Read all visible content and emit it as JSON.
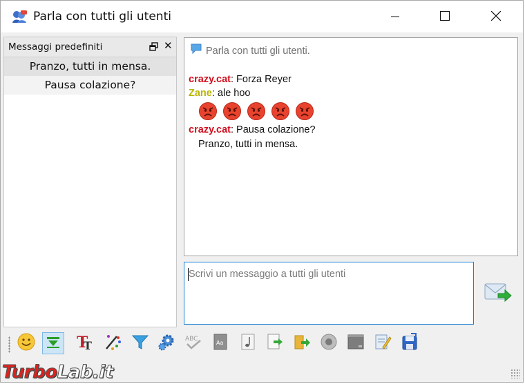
{
  "window": {
    "title": "Parla con tutti gli utenti",
    "icons": {
      "app": "chat-people-icon",
      "minimize": "minimize-icon",
      "maximize": "maximize-icon",
      "close": "close-icon"
    }
  },
  "predefined_panel": {
    "title": "Messaggi predefiniti",
    "float_icon": "float-window-icon",
    "close_label": "✕",
    "items": [
      {
        "label": "Pranzo, tutti in mensa.",
        "selected": true
      },
      {
        "label": "Pausa colazione?",
        "selected": false
      }
    ]
  },
  "chat": {
    "header": "Parla con tutti gli utenti.",
    "messages": [
      {
        "nick": "crazy.cat",
        "nick_color": "#d10f1e",
        "separator": ":",
        "text": " Forza Reyer"
      },
      {
        "nick": "Zane",
        "nick_color": "#b9b400",
        "separator": ":",
        "text": " ale hoo"
      },
      {
        "nick": "crazy.cat",
        "nick_color": "#d10f1e",
        "separator": ":",
        "text": " Pausa colazione?"
      }
    ],
    "continuation": "Pranzo, tutti in mensa.",
    "emojis": [
      "angry-face-icon",
      "angry-face-icon",
      "angry-face-icon",
      "angry-face-icon",
      "angry-face-icon"
    ]
  },
  "input": {
    "placeholder": "Scrivi un messaggio a tutti gli utenti",
    "send_icon": "send-message-icon"
  },
  "toolbar": {
    "items": [
      "smiley-icon",
      "collapse-panel-icon",
      "font-icon",
      "color-picker-icon",
      "filter-icon",
      "settings-gear-icon",
      "spellcheck-icon",
      "dictionary-icon",
      "sound-icon",
      "insert-file-icon",
      "export-icon",
      "record-icon",
      "screen-icon",
      "edit-note-icon",
      "save-icon"
    ],
    "active": "collapse-panel-icon"
  },
  "watermark": {
    "part1": "Turbo",
    "part2": "Lab.it"
  },
  "colors": {
    "accent": "#1a7fd4",
    "selection": "#e2e2e2"
  }
}
